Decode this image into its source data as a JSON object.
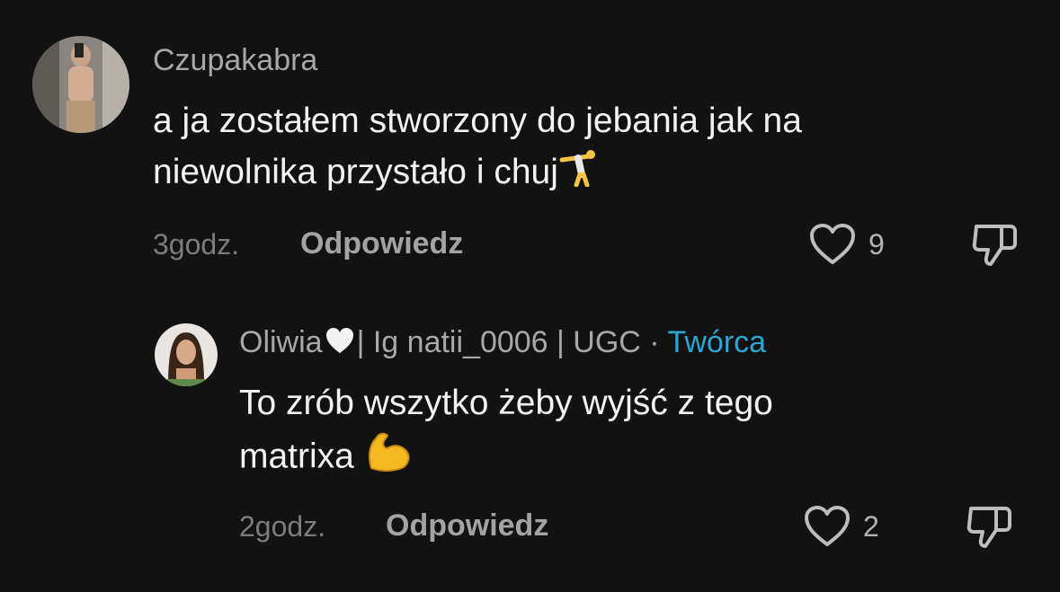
{
  "comments": [
    {
      "username": "Czupakabra",
      "text_line1": "a ja zostałem stworzony do jebania jak na",
      "text_line2": "niewolnika przystało i chuj",
      "emoji": "cartwheel-emoji",
      "time": "3godz.",
      "reply_label": "Odpowiedz",
      "likes": "9"
    },
    {
      "username": "Oliwia",
      "username_suffix": "| Ig natii_0006 | UGC · ",
      "creator_badge": "Twórca",
      "text_line1": "To zrób wszytko żeby wyjść z tego",
      "text_line2": "matrixa",
      "emoji": "flexed-biceps-emoji",
      "time": "2godz.",
      "reply_label": "Odpowiedz",
      "likes": "2"
    }
  ],
  "colors": {
    "background": "#121212",
    "username": "#a8a8a8",
    "creator_badge": "#2aa6d4",
    "body_text": "#f2f2f2",
    "meta_text": "#7c7c7c"
  }
}
